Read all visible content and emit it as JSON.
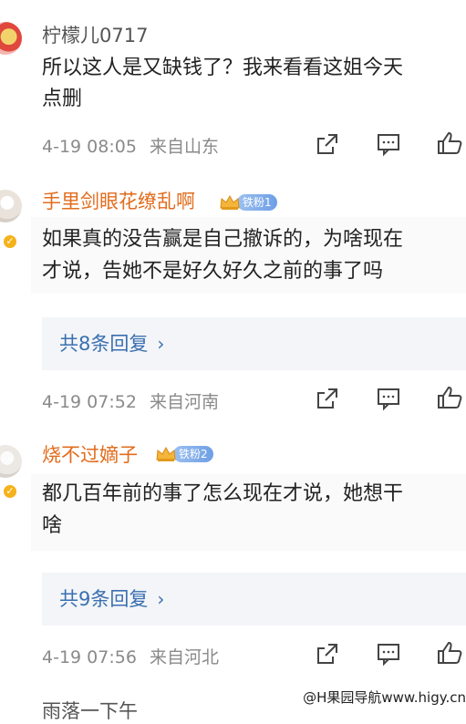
{
  "comments": [
    {
      "username": "柠檬儿0717",
      "username_style": "plain",
      "text_lines": [
        "所以这人是又缺钱了？我来看看这姐今天",
        "点删"
      ],
      "date": "4-19 08:05",
      "location": "来自山东"
    },
    {
      "username": "手里剑眼花缭乱啊",
      "username_style": "vip",
      "badge": "铁粉1",
      "text_lines": [
        "如果真的没告赢是自己撤诉的，为啥现在",
        "才说，告她不是好久好久之前的事了吗"
      ],
      "replies_label": "共8条回复",
      "date": "4-19 07:52",
      "location": "来自河南"
    },
    {
      "username": "烧不过嫡子",
      "username_style": "vip",
      "badge": "铁粉2",
      "text_lines": [
        "都几百年前的事了怎么现在才说，她想干",
        "啥"
      ],
      "replies_label": "共9条回复",
      "date": "4-19 07:56",
      "location": "来自河北"
    }
  ],
  "next_username_partial": "雨落一下午",
  "watermark": "@H果园导航www.higy.cn",
  "icons": {
    "share": "share-icon",
    "comment": "comment-icon",
    "like": "thumbs-up-icon",
    "verified": "verified-badge-icon",
    "crown": "crown-icon",
    "chevron": "chevron-right-icon"
  },
  "colors": {
    "vip_name": "#e26c1c",
    "reply_link": "#3a6fb0",
    "meta": "#8a8a8a"
  }
}
